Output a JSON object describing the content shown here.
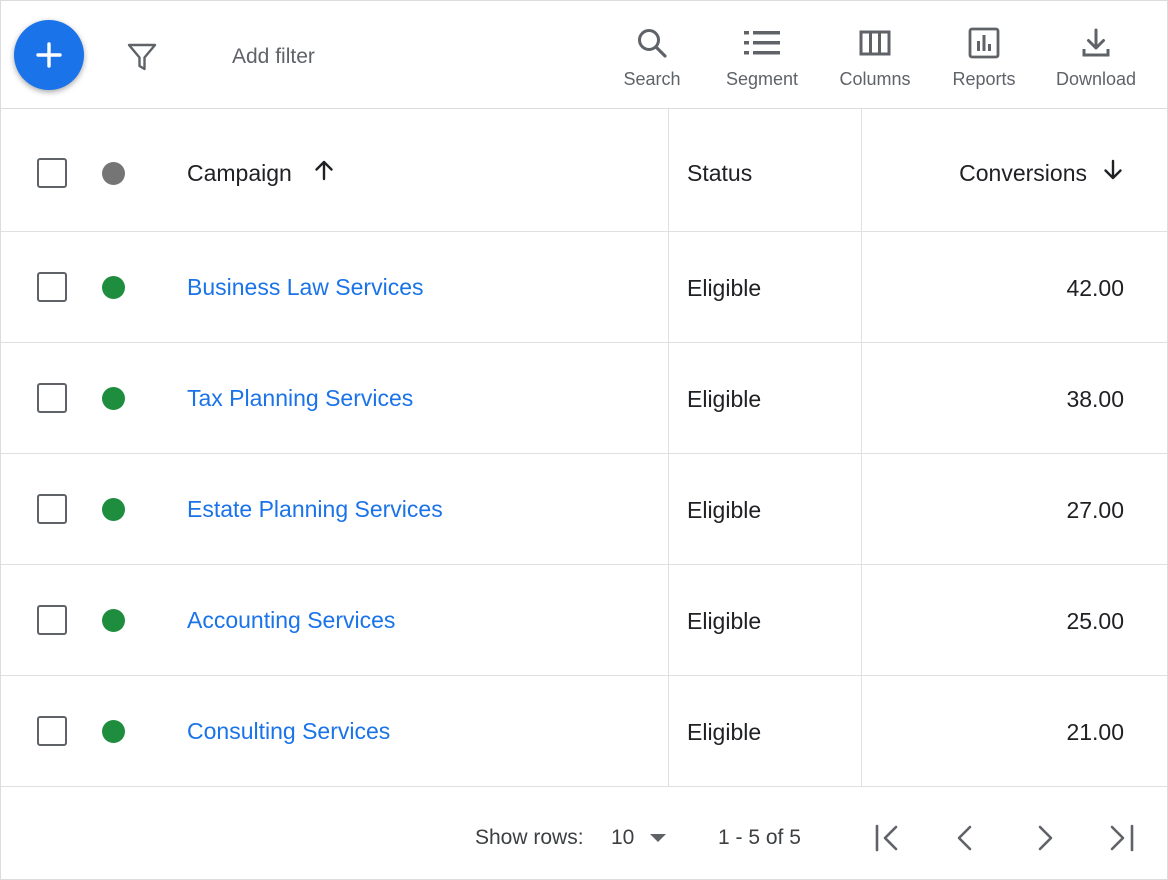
{
  "toolbar": {
    "add_filter_placeholder": "Add filter",
    "tools": {
      "search": "Search",
      "segment": "Segment",
      "columns": "Columns",
      "reports": "Reports",
      "download": "Download"
    },
    "icons": {
      "fab": "plus-icon",
      "filter": "filter-icon",
      "search": "search-icon",
      "segment": "segment-list-icon",
      "columns": "columns-icon",
      "reports": "reports-chart-icon",
      "download": "download-icon"
    }
  },
  "table": {
    "headers": {
      "campaign": "Campaign",
      "status": "Status",
      "conversions": "Conversions"
    },
    "sort": {
      "campaign": "ascending",
      "conversions": "descending"
    },
    "rows": [
      {
        "campaign": "Business Law Services",
        "status": "Eligible",
        "conversions": "42.00"
      },
      {
        "campaign": "Tax Planning Services",
        "status": "Eligible",
        "conversions": "38.00"
      },
      {
        "campaign": "Estate Planning Services",
        "status": "Eligible",
        "conversions": "27.00"
      },
      {
        "campaign": "Accounting Services",
        "status": "Eligible",
        "conversions": "25.00"
      },
      {
        "campaign": "Consulting Services",
        "status": "Eligible",
        "conversions": "21.00"
      }
    ]
  },
  "footer": {
    "show_rows_label": "Show rows:",
    "rows_value": "10",
    "range": "1 - 5 of 5"
  },
  "colors": {
    "accent": "#1a73e8",
    "status_enabled": "#1e8e3e",
    "status_header": "#757575"
  }
}
